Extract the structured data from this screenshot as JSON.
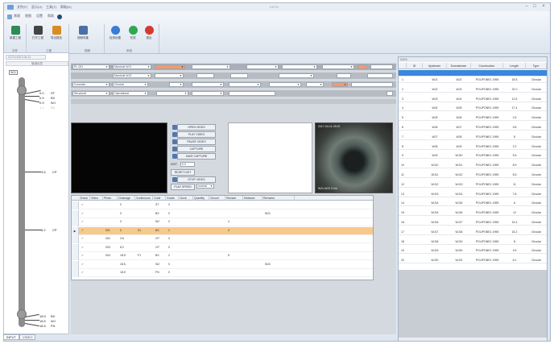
{
  "titlebar": {
    "menu": [
      "文件(F)",
      "显示(V)",
      "工具(T)",
      "帮助(H)"
    ],
    "title": "CCTV",
    "min": "–",
    "max": "□",
    "close": "×"
  },
  "ribbon": {
    "quick": [
      "常规",
      "视图",
      "设置",
      "帮助"
    ],
    "tools": [
      {
        "label": "新建工程",
        "icon": "new-project-icon",
        "color": "#2e8b57"
      },
      {
        "label": "打开工程",
        "icon": "open-project-icon",
        "color": "#444444"
      },
      {
        "label": "导出报告",
        "icon": "export-icon",
        "color": "#d98c1f"
      },
      {
        "label": "视频采集",
        "icon": "camera-icon",
        "color": "#4a6fa5"
      },
      {
        "label": "检测设置",
        "icon": "settings-icon",
        "color": "#3a7bd5"
      },
      {
        "label": "完成",
        "icon": "check-icon",
        "color": "#2fa84f"
      },
      {
        "label": "退出",
        "icon": "exit-icon",
        "color": "#d63a2e"
      }
    ],
    "groups": [
      "文件",
      "工程",
      "视频",
      "系统"
    ]
  },
  "left_panel": {
    "tab": "CCTV-2017-04-11",
    "subheader": "管道信息",
    "top_label": "WJ1",
    "observations": [
      {
        "dist": "0.0",
        "code": "ST"
      },
      {
        "dist": "0.9",
        "code": "BX"
      },
      {
        "dist": "0.9",
        "code": "WJ"
      },
      {
        "dist": "1.1",
        "code": "BX"
      },
      {
        "dist": "3.6",
        "code": "CP"
      },
      {
        "dist": "8.2",
        "code": "CP"
      },
      {
        "dist": "18.5",
        "code": "BX"
      },
      {
        "dist": "18.5",
        "code": "WJ"
      },
      {
        "dist": "18.5",
        "code": "FN"
      }
    ],
    "bottom_tabs": [
      "INPUT",
      "VIDEO"
    ]
  },
  "form": {
    "rows": [
      {
        "fields": [
          {
            "label": "",
            "value": "PL-001",
            "orange": false
          },
          {
            "label": "",
            "value": "Manhole WJ1",
            "orange": false
          },
          {
            "label": "",
            "value": "",
            "orange": true
          },
          {
            "label": "",
            "value": "",
            "orange": false
          },
          {
            "label": "",
            "value": "",
            "orange": false
          },
          {
            "label": "",
            "value": "",
            "orange": false
          },
          {
            "label": "",
            "value": "",
            "orange": false
          },
          {
            "label": "",
            "value": "",
            "orange": true
          }
        ]
      },
      {
        "fields": [
          {
            "label": "",
            "value": "",
            "orange": false
          },
          {
            "label": "",
            "value": "Manhole WJ2",
            "orange": false
          },
          {
            "label": "",
            "value": "",
            "orange": false
          },
          {
            "label": "",
            "value": "",
            "orange": false
          },
          {
            "label": "",
            "value": "",
            "orange": false
          },
          {
            "label": "",
            "value": "",
            "orange": false
          },
          {
            "label": "",
            "value": "",
            "orange": false
          }
        ]
      },
      {
        "fields": [
          {
            "label": "",
            "value": "Concrete",
            "orange": false
          },
          {
            "label": "",
            "value": "Circular",
            "orange": false
          },
          {
            "label": "",
            "value": "",
            "orange": false
          },
          {
            "label": "",
            "value": "",
            "orange": false
          },
          {
            "label": "",
            "value": "",
            "orange": false
          },
          {
            "label": "",
            "value": "",
            "orange": false
          },
          {
            "label": "",
            "value": "",
            "orange": true
          },
          {
            "label": "",
            "value": "",
            "orange": false
          }
        ]
      },
      {
        "fields": [
          {
            "label": "",
            "value": "Structural",
            "orange": false
          },
          {
            "label": "",
            "value": "Operational",
            "orange": false
          },
          {
            "label": "",
            "value": "",
            "orange": false
          },
          {
            "label": "",
            "value": "",
            "orange": false
          },
          {
            "label": "",
            "value": "",
            "orange": false
          }
        ]
      }
    ]
  },
  "controls": {
    "buttons": [
      "OPEN VIDEO",
      "PLAY VIDEO",
      "PAUSE VIDEO",
      "CAPTURE",
      "SAVE CAPTURE"
    ],
    "dist_label": "DIST",
    "dist_value": "0.0",
    "reset": "RESET DIST",
    "stop": "STOP VIDEO",
    "play_speed": "PLAY SPEED",
    "speed_value": "normal"
  },
  "video": {
    "osd_top": "2017-04-11 09:22",
    "osd_bottom": "WJ1-WJ2  0.0m"
  },
  "grid": {
    "headers": [
      "Check",
      "Video",
      "Photo",
      "Chainage",
      "Continuous",
      "Code",
      "Grade",
      "Clock",
      "Quantity",
      "Circum",
      "Remark",
      "Distance",
      "Remarks"
    ],
    "rows": [
      {
        "num": "",
        "check": "✓",
        "video": "",
        "photo": "",
        "chain": "0",
        "cont": "",
        "code": "ST",
        "grade": "0",
        "clock": "",
        "qty": "",
        "circ": "",
        "remark": "",
        "dist": "",
        "rem2": ""
      },
      {
        "num": "",
        "check": "✓",
        "video": "",
        "photo": "",
        "chain": "0",
        "cont": "",
        "code": "BX",
        "grade": "0",
        "clock": "",
        "qty": "",
        "circ": "",
        "remark": "",
        "dist": "",
        "rem2": "WJ1"
      },
      {
        "num": "",
        "check": "✓",
        "video": "",
        "photo": "",
        "chain": "0",
        "cont": "",
        "code": "WJ",
        "grade": "0",
        "clock": "",
        "qty": "",
        "circ": "",
        "remark": "4",
        "dist": "",
        "rem2": ""
      },
      {
        "num": "▶",
        "check": "✓",
        "video": "",
        "photo": "001",
        "chain": "0",
        "cont": "S1",
        "code": "BX",
        "grade": "1",
        "clock": "",
        "qty": "",
        "circ": "",
        "remark": "4",
        "dist": "",
        "rem2": ""
      },
      {
        "num": "",
        "check": "✓",
        "video": "",
        "photo": "002",
        "chain": "3.6",
        "cont": "",
        "code": "CP",
        "grade": "0",
        "clock": "",
        "qty": "",
        "circ": "",
        "remark": "",
        "dist": "",
        "rem2": ""
      },
      {
        "num": "",
        "check": "✓",
        "video": "",
        "photo": "003",
        "chain": "8.2",
        "cont": "",
        "code": "CP",
        "grade": "0",
        "clock": "",
        "qty": "",
        "circ": "",
        "remark": "",
        "dist": "",
        "rem2": ""
      },
      {
        "num": "",
        "check": "✓",
        "video": "",
        "photo": "004",
        "chain": "18.5",
        "cont": "F1",
        "code": "BX",
        "grade": "2",
        "clock": "",
        "qty": "",
        "circ": "",
        "remark": "5",
        "dist": "",
        "rem2": ""
      },
      {
        "num": "",
        "check": "✓",
        "video": "",
        "photo": "",
        "chain": "18.5",
        "cont": "",
        "code": "WJ",
        "grade": "0",
        "clock": "",
        "qty": "",
        "circ": "",
        "remark": "",
        "dist": "",
        "rem2": "WJ2"
      },
      {
        "num": "",
        "check": "✓",
        "video": "",
        "photo": "",
        "chain": "18.5",
        "cont": "",
        "code": "FN",
        "grade": "0",
        "clock": "",
        "qty": "",
        "circ": "",
        "remark": "",
        "dist": "",
        "rem2": ""
      }
    ]
  },
  "right_panel": {
    "title": "DATA",
    "headers": [
      "",
      "ID",
      "Upstream",
      "Downstream",
      "Construction",
      "Length",
      "Type"
    ],
    "rows": [
      {
        "n": "1",
        "id": "",
        "up": "WJ1",
        "down": "WJ2",
        "cons": "POLIPONE1 1995",
        "len": "18.5",
        "type": "Circular"
      },
      {
        "n": "2",
        "id": "",
        "up": "WJ2",
        "down": "WJ3",
        "cons": "POLIPONE1 1995",
        "len": "22.0",
        "type": "Circular"
      },
      {
        "n": "3",
        "id": "",
        "up": "WJ3",
        "down": "WJ4",
        "cons": "POLIPONE1 1995",
        "len": "12.6",
        "type": "Circular"
      },
      {
        "n": "4",
        "id": "",
        "up": "WJ4",
        "down": "WJ5",
        "cons": "POLIPONE1 1995",
        "len": "17.4",
        "type": "Circular"
      },
      {
        "n": "5",
        "id": "",
        "up": "WJ5",
        "down": "WJ6",
        "cons": "POLIPONE1 1995",
        "len": "2.5",
        "type": "Circular"
      },
      {
        "n": "6",
        "id": "",
        "up": "WJ6",
        "down": "WJ7",
        "cons": "POLIPONE1 1995",
        "len": "9.8",
        "type": "Circular"
      },
      {
        "n": "7",
        "id": "",
        "up": "WJ7",
        "down": "WJ8",
        "cons": "POLIPONE1 1995",
        "len": "8",
        "type": "Circular"
      },
      {
        "n": "8",
        "id": "",
        "up": "WJ8",
        "down": "WJ9",
        "cons": "POLIPONE1 1995",
        "len": "2.2",
        "type": "Circular"
      },
      {
        "n": "9",
        "id": "",
        "up": "WJ9",
        "down": "WJ10",
        "cons": "POLIPONE1 1995",
        "len": "5.5",
        "type": "Circular"
      },
      {
        "n": "10",
        "id": "",
        "up": "WJ10",
        "down": "WJ11",
        "cons": "POLIPONE1 1995",
        "len": "8.9",
        "type": "Circular"
      },
      {
        "n": "11",
        "id": "",
        "up": "WJ11",
        "down": "WJ12",
        "cons": "POLIPONE1 1995",
        "len": "6.5",
        "type": "Circular"
      },
      {
        "n": "12",
        "id": "",
        "up": "WJ12",
        "down": "WJ13",
        "cons": "POLIPONE1 1995",
        "len": "11",
        "type": "Circular"
      },
      {
        "n": "13",
        "id": "",
        "up": "WJ13",
        "down": "WJ14",
        "cons": "POLIPONE1 1995",
        "len": "7.8",
        "type": "Circular"
      },
      {
        "n": "14",
        "id": "",
        "up": "WJ14",
        "down": "WJ15",
        "cons": "POLIPONE1 1995",
        "len": "6",
        "type": "Circular"
      },
      {
        "n": "15",
        "id": "",
        "up": "WJ15",
        "down": "WJ16",
        "cons": "POLIPONE1 1995",
        "len": "12",
        "type": "Circular"
      },
      {
        "n": "16",
        "id": "",
        "up": "WJ16",
        "down": "WJ17",
        "cons": "POLIPONE1 1995",
        "len": "15.4",
        "type": "Circular"
      },
      {
        "n": "17",
        "id": "",
        "up": "WJ17",
        "down": "WJ18",
        "cons": "POLIPONE1 1995",
        "len": "16.2",
        "type": "Circular"
      },
      {
        "n": "18",
        "id": "",
        "up": "WJ18",
        "down": "WJ19",
        "cons": "POLIPONE1 1995",
        "len": "8",
        "type": "Circular"
      },
      {
        "n": "19",
        "id": "",
        "up": "WJ19",
        "down": "WJ20",
        "cons": "POLIPONE1 1995",
        "len": "4.5",
        "type": "Circular"
      },
      {
        "n": "20",
        "id": "",
        "up": "WJ20",
        "down": "WJ21",
        "cons": "POLIPONE1 1995",
        "len": "6.1",
        "type": "Circular"
      }
    ]
  }
}
